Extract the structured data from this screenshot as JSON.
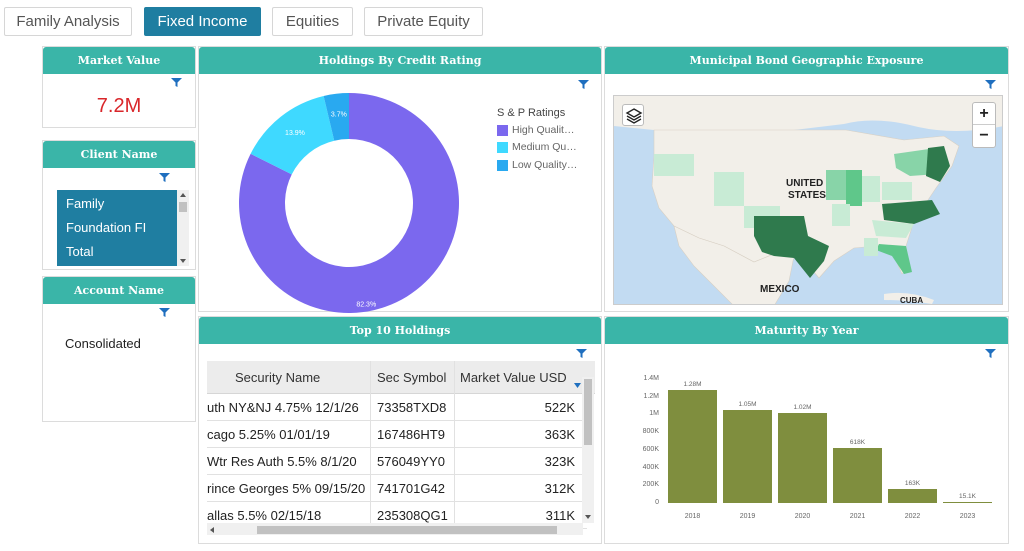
{
  "tabs": [
    {
      "label": "Family Analysis",
      "active": false
    },
    {
      "label": "Fixed Income",
      "active": true
    },
    {
      "label": "Equities",
      "active": false
    },
    {
      "label": "Private Equity",
      "active": false
    }
  ],
  "market_value": {
    "title": "Market Value",
    "value": "7.2M"
  },
  "client_name": {
    "title": "Client Name",
    "items": [
      "Family",
      "Foundation FI",
      "Total"
    ]
  },
  "account_name": {
    "title": "Account Name",
    "value": "Consolidated"
  },
  "credit_rating": {
    "title": "Holdings By Credit Rating",
    "legend_title": "S & P Ratings",
    "chart_data": {
      "type": "pie",
      "slices": [
        {
          "label": "High Qualit…",
          "value": 82.3,
          "display": "82.3%",
          "color": "#7b68ee"
        },
        {
          "label": "Medium Qu…",
          "value": 13.9,
          "display": "13.9%",
          "color": "#3fd9ff"
        },
        {
          "label": "Low Quality…",
          "value": 3.7,
          "display": "3.7%",
          "color": "#29a9f0"
        }
      ]
    }
  },
  "muni_map": {
    "title": "Municipal Bond Geographic Exposure",
    "labels": {
      "country": "UNITED\nSTATES",
      "country_a": "UNITED",
      "country_b": "STATES",
      "mexico": "MEXICO",
      "cuba": "CUBA"
    },
    "zoom_in": "+",
    "zoom_out": "−"
  },
  "top_holdings": {
    "title": "Top 10 Holdings",
    "columns": [
      "Security Name",
      "Sec Symbol",
      "Market Value USD"
    ],
    "rows": [
      [
        "uth NY&NJ 4.75% 12/1/26",
        "73358TXD8",
        "522K"
      ],
      [
        "cago 5.25% 01/01/19",
        "167486HT9",
        "363K"
      ],
      [
        " Wtr Res Auth 5.5% 8/1/20",
        "576049YY0",
        "323K"
      ],
      [
        "rince Georges 5% 09/15/20",
        "741701G42",
        "312K"
      ],
      [
        "allas 5.5% 02/15/18",
        "235308QG1",
        "311K"
      ]
    ]
  },
  "maturity": {
    "title": "Maturity By Year",
    "chart_data": {
      "type": "bar",
      "categories": [
        "2018",
        "2019",
        "2020",
        "2021",
        "2022",
        "2023"
      ],
      "values": [
        1280000,
        1050000,
        1020000,
        618000,
        163000,
        15100
      ],
      "value_labels": [
        "1.28M",
        "1.05M",
        "1.02M",
        "618K",
        "163K",
        "15.1K"
      ],
      "yticks": [
        "1.4M",
        "1.2M",
        "1M",
        "800K",
        "600K",
        "400K",
        "200K",
        "0"
      ],
      "ylim": [
        0,
        1400000
      ],
      "color": "#7f8e3e"
    }
  }
}
